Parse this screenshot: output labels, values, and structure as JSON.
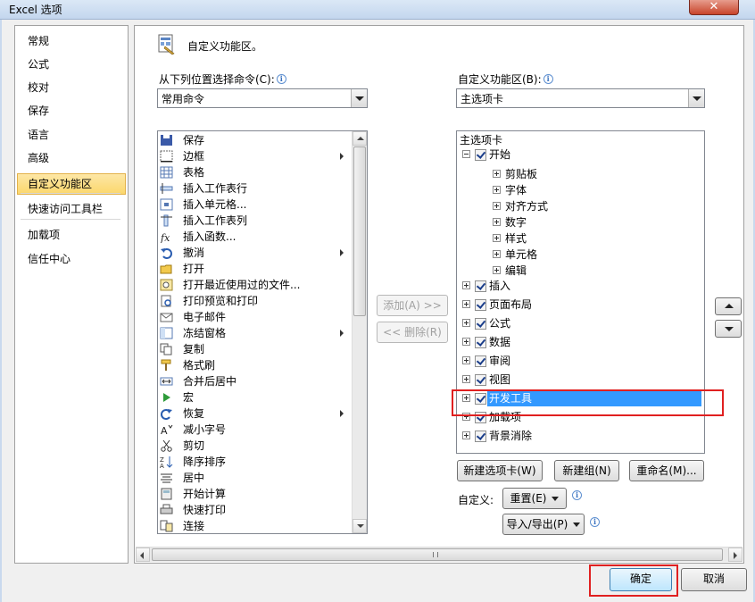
{
  "window": {
    "title": "Excel 选项",
    "close": "✕"
  },
  "nav": {
    "items": [
      {
        "label": "常规"
      },
      {
        "label": "公式"
      },
      {
        "label": "校对"
      },
      {
        "label": "保存"
      },
      {
        "label": "语言"
      },
      {
        "label": "高级"
      },
      {
        "label": "自定义功能区"
      },
      {
        "label": "快速访问工具栏"
      },
      {
        "label": "加载项"
      },
      {
        "label": "信任中心"
      }
    ],
    "selected": "自定义功能区"
  },
  "main": {
    "header": "自定义功能区。",
    "left_label": "从下列位置选择命令(C):",
    "left_combo_value": "常用命令",
    "right_label": "自定义功能区(B):",
    "right_combo_value": "主选项卡",
    "commands": [
      {
        "label": "保存",
        "icon": "save-icon"
      },
      {
        "label": "边框",
        "icon": "border-icon",
        "sub": true
      },
      {
        "label": "表格",
        "icon": "table-icon"
      },
      {
        "label": "插入工作表行",
        "icon": "insert-row-icon"
      },
      {
        "label": "插入单元格...",
        "icon": "insert-cell-icon"
      },
      {
        "label": "插入工作表列",
        "icon": "insert-column-icon"
      },
      {
        "label": "插入函数...",
        "icon": "function-icon"
      },
      {
        "label": "撤消",
        "icon": "undo-icon",
        "sub": true
      },
      {
        "label": "打开",
        "icon": "open-folder-icon"
      },
      {
        "label": "打开最近使用过的文件...",
        "icon": "recent-file-icon"
      },
      {
        "label": "打印预览和打印",
        "icon": "print-preview-icon"
      },
      {
        "label": "电子邮件",
        "icon": "email-icon"
      },
      {
        "label": "冻结窗格",
        "icon": "freeze-panes-icon",
        "sub": true
      },
      {
        "label": "复制",
        "icon": "copy-icon"
      },
      {
        "label": "格式刷",
        "icon": "format-painter-icon"
      },
      {
        "label": "合并后居中",
        "icon": "merge-center-icon"
      },
      {
        "label": "宏",
        "icon": "macro-icon"
      },
      {
        "label": "恢复",
        "icon": "redo-icon",
        "sub": true
      },
      {
        "label": "减小字号",
        "icon": "decrease-font-icon"
      },
      {
        "label": "剪切",
        "icon": "cut-icon"
      },
      {
        "label": "降序排序",
        "icon": "sort-desc-icon"
      },
      {
        "label": "居中",
        "icon": "align-center-icon"
      },
      {
        "label": "开始计算",
        "icon": "calculate-icon"
      },
      {
        "label": "快速打印",
        "icon": "quick-print-icon"
      },
      {
        "label": "连接",
        "icon": "connection-icon"
      }
    ],
    "add_button": "添加(A) >>",
    "remove_button": "<< 删除(R)",
    "tree_header": "主选项卡",
    "tree": [
      {
        "label": "开始",
        "level": 0,
        "expanded": true,
        "checked": true
      },
      {
        "label": "剪贴板",
        "level": 1
      },
      {
        "label": "字体",
        "level": 1
      },
      {
        "label": "对齐方式",
        "level": 1
      },
      {
        "label": "数字",
        "level": 1
      },
      {
        "label": "样式",
        "level": 1
      },
      {
        "label": "单元格",
        "level": 1
      },
      {
        "label": "编辑",
        "level": 1
      },
      {
        "label": "插入",
        "level": 0,
        "checked": true
      },
      {
        "label": "页面布局",
        "level": 0,
        "checked": true
      },
      {
        "label": "公式",
        "level": 0,
        "checked": true
      },
      {
        "label": "数据",
        "level": 0,
        "checked": true
      },
      {
        "label": "审阅",
        "level": 0,
        "checked": true
      },
      {
        "label": "视图",
        "level": 0,
        "checked": true
      },
      {
        "label": "开发工具",
        "level": 0,
        "checked": true,
        "selected": true
      },
      {
        "label": "加载项",
        "level": 0,
        "checked": true
      },
      {
        "label": "背景消除",
        "level": 0,
        "checked": true
      }
    ],
    "new_tab_button": "新建选项卡(W)",
    "new_group_button": "新建组(N)",
    "rename_button": "重命名(M)...",
    "customize_label": "自定义:",
    "reset_button": "重置(E)",
    "import_export_button": "导入/导出(P)"
  },
  "footer": {
    "ok": "确定",
    "cancel": "取消"
  },
  "colors": {
    "selected_nav": "#fbd76c",
    "tree_selection": "#3399ff",
    "highlight": "#e02020"
  }
}
